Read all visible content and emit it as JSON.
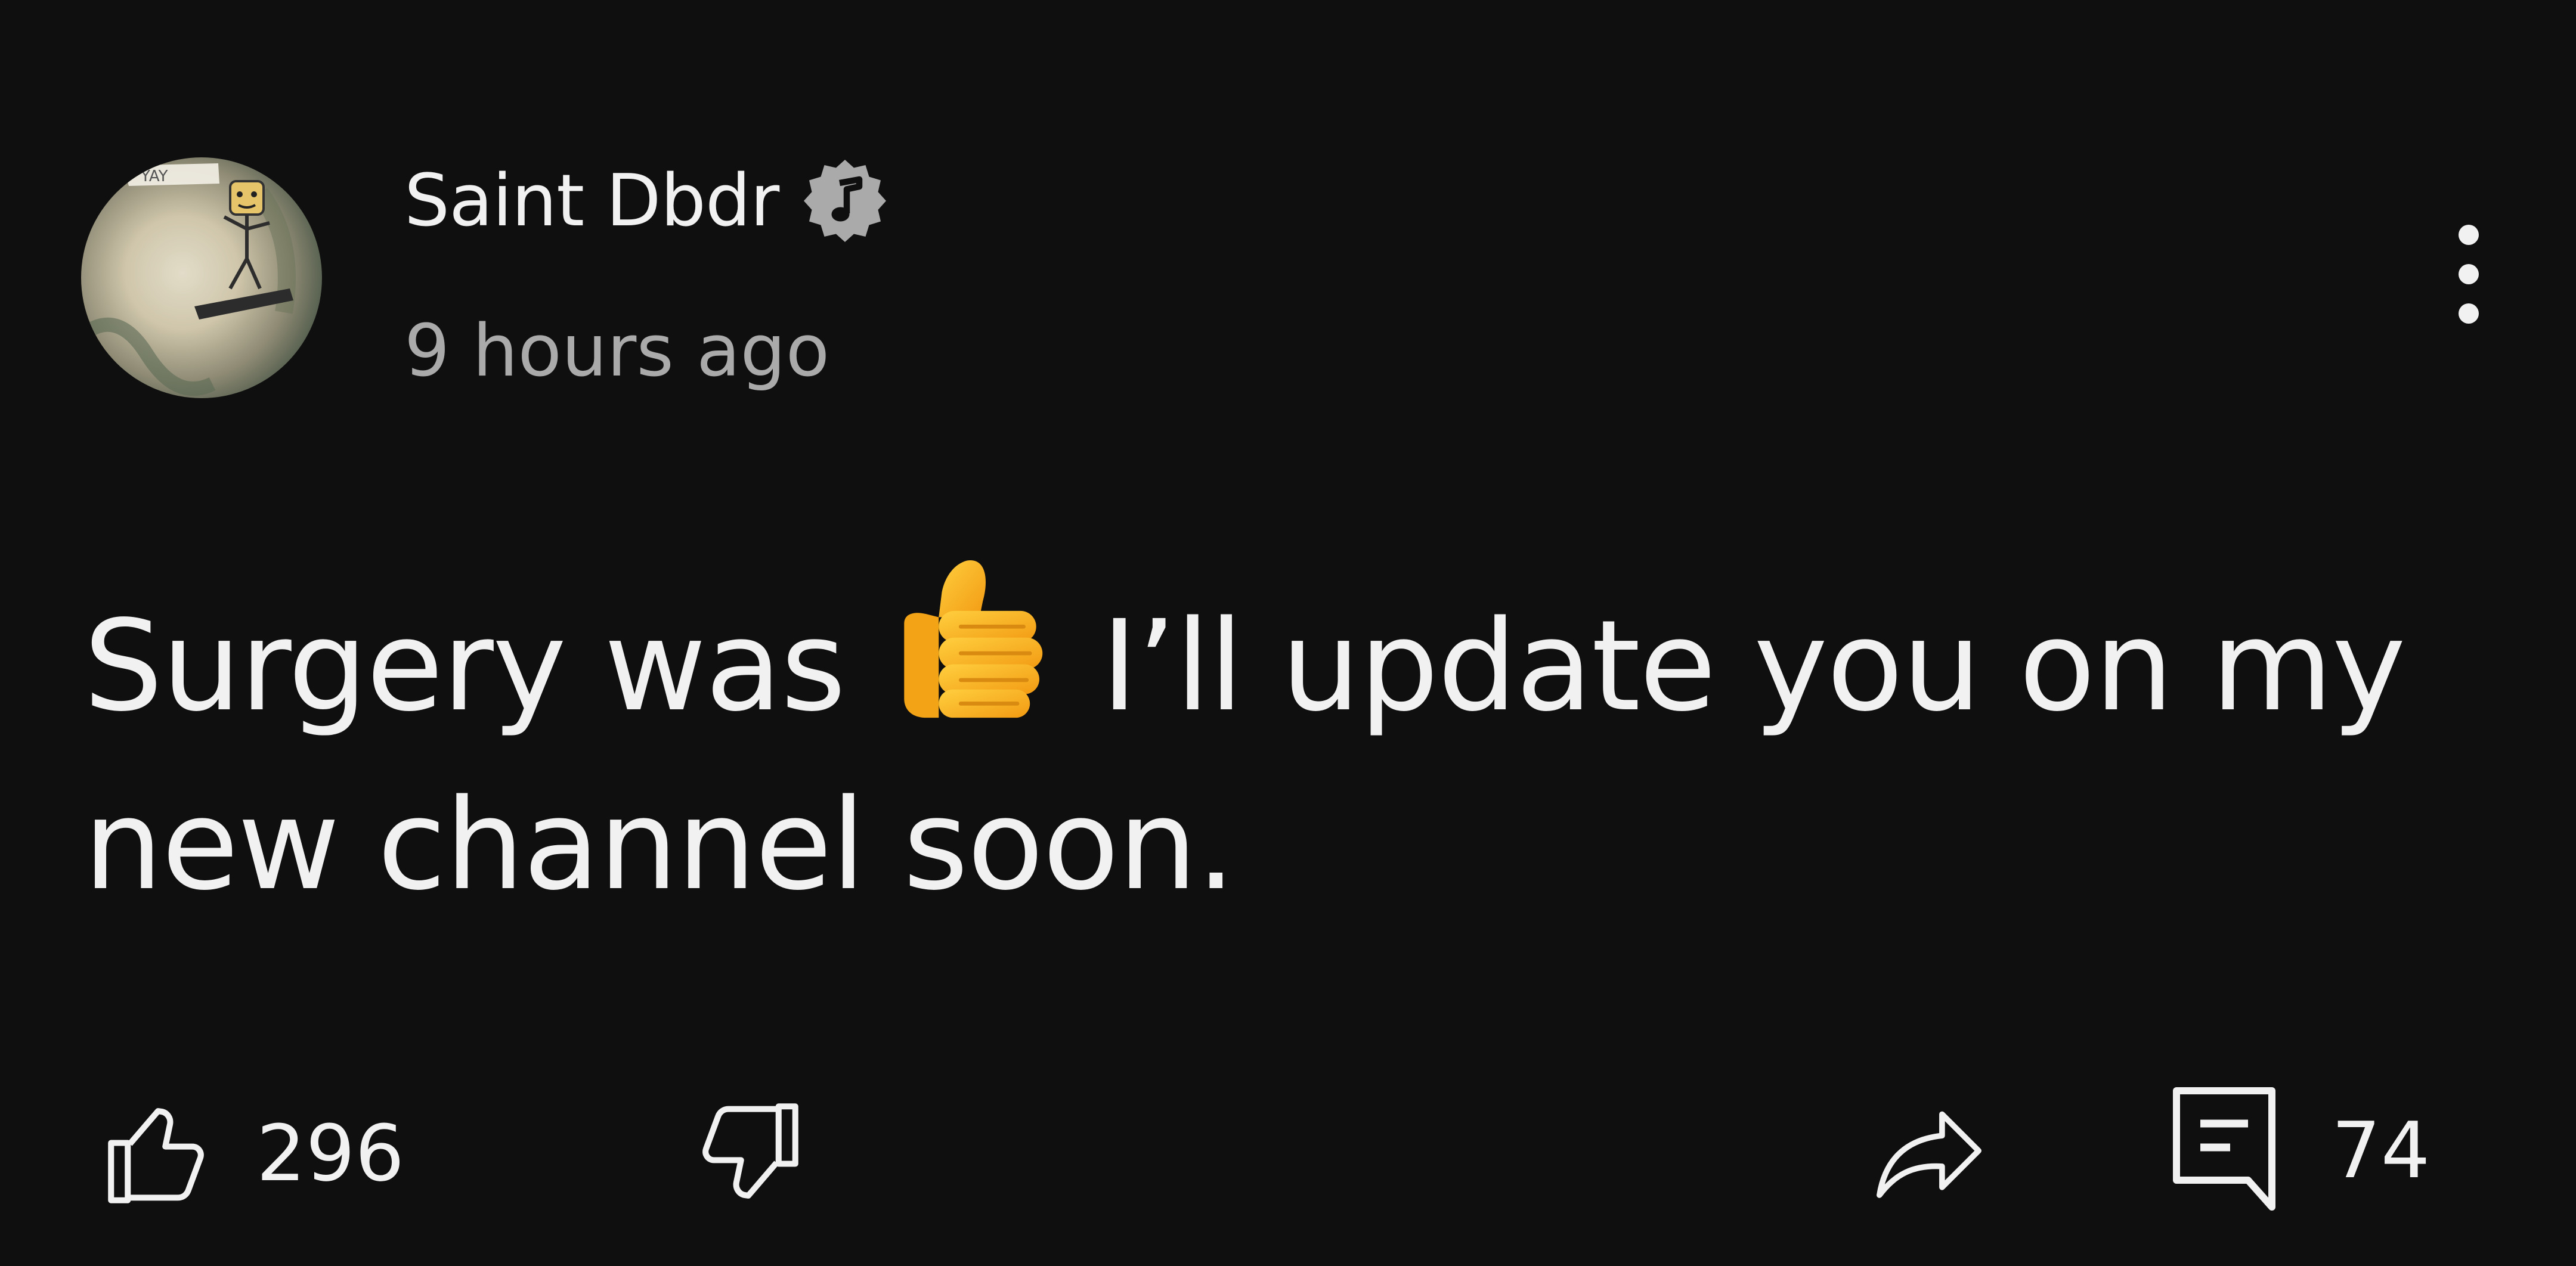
{
  "post": {
    "author": "Saint Dbdr",
    "timestamp": "9 hours ago",
    "text_before_emoji": "Surgery was ",
    "text_after_emoji": " I’ll update you on my new channel soon.",
    "emoji": "thumbs-up",
    "likes": "296",
    "comments": "74"
  },
  "icons": {
    "verified": "music-note-badge-icon",
    "more": "vertical-ellipsis-icon",
    "like": "thumb-up-outline-icon",
    "dislike": "thumb-down-outline-icon",
    "share": "share-arrow-icon",
    "comment": "comment-bubble-icon"
  },
  "colors": {
    "background": "#0f0f0f",
    "text": "#f1f1f1",
    "secondary_text": "#aaaaaa",
    "badge": "#aaaaaa"
  }
}
